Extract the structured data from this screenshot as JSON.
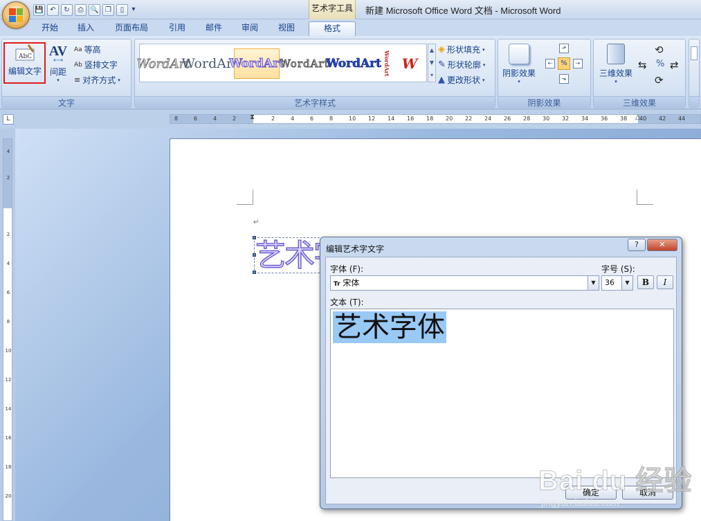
{
  "window": {
    "tool_tab": "艺术字工具",
    "title": "新建 Microsoft Office Word 文档 - Microsoft Word"
  },
  "tabs": [
    "开始",
    "插入",
    "页面布局",
    "引用",
    "邮件",
    "审阅",
    "视图",
    "格式"
  ],
  "active_tab": "格式",
  "ribbon": {
    "text_group": {
      "label": "文字",
      "edit_text": "编辑文字",
      "spacing": "间距",
      "equal_height": "等高",
      "vertical_text": "竖排文字",
      "align": "对齐方式"
    },
    "styles_group": {
      "label": "艺术字样式",
      "gallery": [
        "WordArt",
        "WordArt",
        "WordArt",
        "WordArt",
        "WordArt",
        "WordArt",
        "W"
      ],
      "selected_index": 2,
      "shape_fill": "形状填充",
      "shape_outline": "形状轮廓",
      "change_shape": "更改形状"
    },
    "shadow_group": {
      "label": "阴影效果",
      "shadow_effects": "阴影效果"
    },
    "threed_group": {
      "label": "三维效果",
      "threed_effects": "三维效果"
    }
  },
  "ruler": {
    "h_ticks": [
      "8",
      "6",
      "4",
      "2",
      "2",
      "4",
      "6",
      "8",
      "10",
      "12",
      "14",
      "16",
      "18",
      "20",
      "22",
      "24",
      "26",
      "28",
      "30",
      "32",
      "34",
      "36",
      "38",
      "40",
      "42",
      "44"
    ],
    "v_ticks": [
      "4",
      "2",
      "2",
      "4",
      "6",
      "8",
      "10",
      "12",
      "14",
      "16",
      "18",
      "20"
    ],
    "corner": "L"
  },
  "document": {
    "paragraph_mark": "↵",
    "wordart_text": "艺术字"
  },
  "dialog": {
    "title": "编辑艺术字文字",
    "help": "?",
    "close": "✕",
    "font_label": "字体 (F):",
    "font_value": "宋体",
    "font_prefix": "Tr",
    "size_label": "字号 (S):",
    "size_value": "36",
    "bold": "B",
    "italic": "I",
    "text_label": "文本 (T):",
    "text_value": "艺术字体",
    "ok": "确定",
    "cancel": "取消"
  },
  "watermark": {
    "logo": "Bai du 经验",
    "url": "jingyan.baidu.com"
  }
}
